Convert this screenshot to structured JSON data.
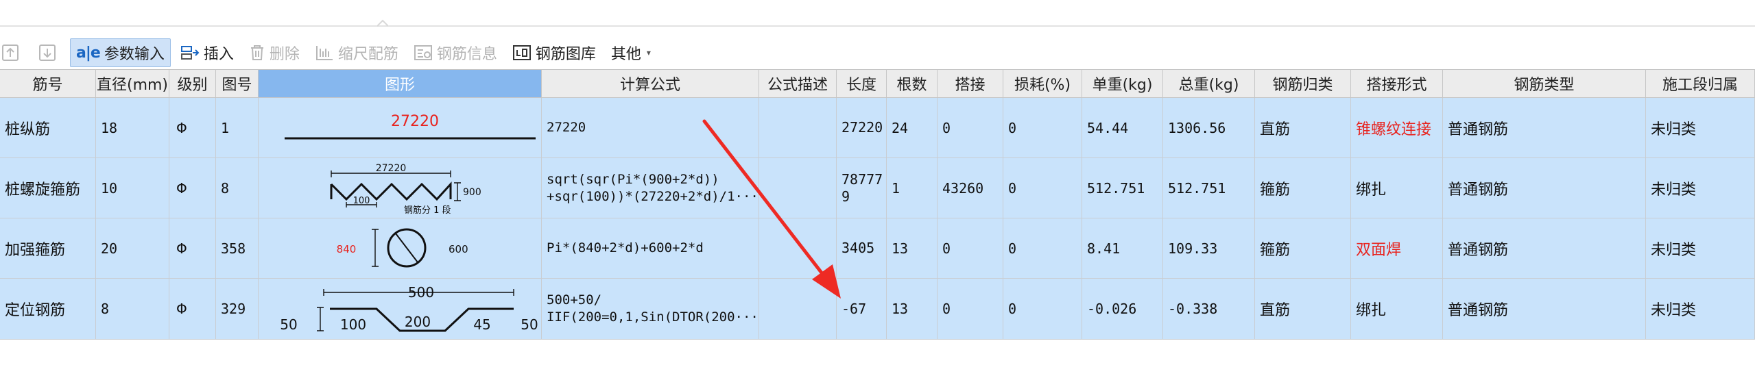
{
  "toolbar": {
    "items": [
      {
        "label": "",
        "icon": "move-up-icon",
        "disabled": true
      },
      {
        "label": "",
        "icon": "move-down-icon",
        "disabled": true
      },
      {
        "label": "参数输入",
        "icon": "param-input-icon",
        "disabled": false,
        "active": true
      },
      {
        "label": "插入",
        "icon": "insert-icon",
        "disabled": false
      },
      {
        "label": "删除",
        "icon": "delete-icon",
        "disabled": true
      },
      {
        "label": "缩尺配筋",
        "icon": "scale-rebar-icon",
        "disabled": true
      },
      {
        "label": "钢筋信息",
        "icon": "rebar-info-icon",
        "disabled": true
      },
      {
        "label": "钢筋图库",
        "icon": "rebar-library-icon",
        "disabled": false
      },
      {
        "label": "其他",
        "icon": "dropdown-caret-icon",
        "disabled": false
      }
    ],
    "param_icon_text": "a|e"
  },
  "table": {
    "headers": [
      "筋号",
      "直径(mm)",
      "级别",
      "图号",
      "图形",
      "计算公式",
      "公式描述",
      "长度",
      "根数",
      "搭接",
      "损耗(%)",
      "单重(kg)",
      "总重(kg)",
      "钢筋归类",
      "搭接形式",
      "钢筋类型",
      "施工段归属"
    ],
    "rows": [
      {
        "name": "桩纵筋",
        "diameter": "18",
        "grade": "Φ",
        "figure_no": "1",
        "formula": [
          "27220"
        ],
        "desc": "",
        "length": [
          "27220"
        ],
        "count": "24",
        "lap": "0",
        "loss": "0",
        "unit_weight": "54.44",
        "total_weight": "1306.56",
        "category": "直筋",
        "lap_type": "锥螺纹连接",
        "lap_type_red": true,
        "rebar_type": "普通钢筋",
        "segment": "未归类"
      },
      {
        "name": "桩螺旋箍筋",
        "diameter": "10",
        "grade": "Φ",
        "figure_no": "8",
        "formula": [
          "sqrt(sqr(Pi*(900+2*d))",
          "+sqr(100))*(27220+2*d)/1···"
        ],
        "desc": "",
        "length": [
          "78777",
          "9"
        ],
        "count": "1",
        "lap": "43260",
        "loss": "0",
        "unit_weight": "512.751",
        "total_weight": "512.751",
        "category": "箍筋",
        "lap_type": "绑扎",
        "lap_type_red": false,
        "rebar_type": "普通钢筋",
        "segment": "未归类"
      },
      {
        "name": "加强箍筋",
        "diameter": "20",
        "grade": "Φ",
        "figure_no": "358",
        "formula": [
          "Pi*(840+2*d)+600+2*d"
        ],
        "desc": "",
        "length": [
          "3405"
        ],
        "count": "13",
        "lap": "0",
        "loss": "0",
        "unit_weight": "8.41",
        "total_weight": "109.33",
        "category": "箍筋",
        "lap_type": "双面焊",
        "lap_type_red": true,
        "rebar_type": "普通钢筋",
        "segment": "未归类"
      },
      {
        "name": "定位钢筋",
        "diameter": "8",
        "grade": "Φ",
        "figure_no": "329",
        "formula": [
          "500+50/",
          "IIF(200=0,1,Sin(DTOR(200···"
        ],
        "desc": "",
        "length": [
          "-67"
        ],
        "count": "13",
        "lap": "0",
        "loss": "0",
        "unit_weight": "-0.026",
        "total_weight": "-0.338",
        "category": "直筋",
        "lap_type": "绑扎",
        "lap_type_red": false,
        "rebar_type": "普通钢筋",
        "segment": "未归类"
      }
    ]
  },
  "shapes": {
    "row1": {
      "value": "27220"
    },
    "row2": {
      "top": "27220",
      "right": "900",
      "bottom_left": "100",
      "caption": "钢筋分 1 段"
    },
    "row3": {
      "left": "840",
      "right": "600"
    },
    "row4": {
      "top": "500",
      "left": "50",
      "a": "100",
      "b": "200",
      "c": "45",
      "right": "50"
    }
  },
  "colors": {
    "row_bg": "#c9e3fb",
    "header_bg": "#ececec",
    "header_selected": "#86b7ee",
    "alert_red": "#e8231e",
    "arrow": "#ee2a24"
  }
}
